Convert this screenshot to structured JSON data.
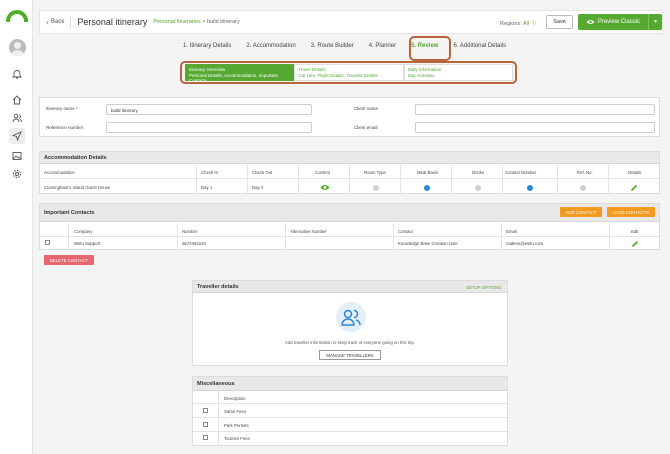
{
  "brand": {
    "accent": "#55a830",
    "highlight": "#b8653b",
    "orange": "#f39a1e",
    "red": "#e6686e",
    "blue": "#2a88d8"
  },
  "sidebar": {
    "icons": [
      "logo-icon",
      "avatar",
      "bell-icon",
      "home-icon",
      "users-icon",
      "send-icon",
      "image-icon",
      "gear-icon"
    ]
  },
  "header": {
    "back_label": "Back",
    "title": "Personal itinerary",
    "crumb_link": "Personal Itineraries",
    "crumb_sep": ">",
    "crumb_current": "build itinerary",
    "regions_label": "Regions:",
    "regions_value": "All",
    "save_label": "Save",
    "preview_label": "Preview Classic"
  },
  "tabs": [
    {
      "label": "1. Itinerary Details"
    },
    {
      "label": "2. Accommodation"
    },
    {
      "label": "3. Route Builder"
    },
    {
      "label": "4. Planner"
    },
    {
      "label": "5. Review"
    },
    {
      "label": "6. Additional Details"
    }
  ],
  "subtabs": [
    {
      "title": "Itinerary Overview",
      "desc": "Personal Details, Accommodation, Important Contacts"
    },
    {
      "title": "Travel Details",
      "desc": "Car Hire, Flight Details, Transfer Details"
    },
    {
      "title": "Daily Information",
      "desc": "Day Activities"
    }
  ],
  "form": {
    "itinerary_name_label": "Itinerary name",
    "itinerary_name_value": "build itinerary",
    "client_name_label": "Client name",
    "reference_label": "Reference number",
    "client_email_label": "Client email"
  },
  "accommodation": {
    "title": "Accommodation Details",
    "headers": [
      "Accommodation",
      "Check In",
      "Check Out",
      "Content",
      "Room Type",
      "Meal Basis",
      "Drinks",
      "Contact Number",
      "Ref. No.",
      "Details"
    ],
    "row": {
      "name": "Cunningham's Island Guest House",
      "check_in": "Day 1",
      "check_out": "Day 4"
    }
  },
  "contacts": {
    "title": "Important Contacts",
    "add_label": "ADD CONTACT",
    "load_label": "LOAD CONTACTS",
    "headers": [
      "Company",
      "Number",
      "Alternative Number",
      "Contact",
      "Email",
      "Edit"
    ],
    "row": {
      "company": "Wetu Support",
      "number": "0672462240",
      "alt": "",
      "contact": "Knowledge Base Creation User",
      "email": "nadene@wetu.com"
    },
    "delete_label": "DELETE CONTACT"
  },
  "traveller": {
    "title": "Traveller details",
    "setup_label": "SETUP OPTIONS",
    "text": "Add traveller information to keep track of everyone going on this trip.",
    "manage_label": "MANAGE TRAVELLERS"
  },
  "misc": {
    "title": "Miscellaneous",
    "header": "Description",
    "items": [
      "Safari Fees",
      "Park Permits",
      "Tourism Fees"
    ]
  }
}
